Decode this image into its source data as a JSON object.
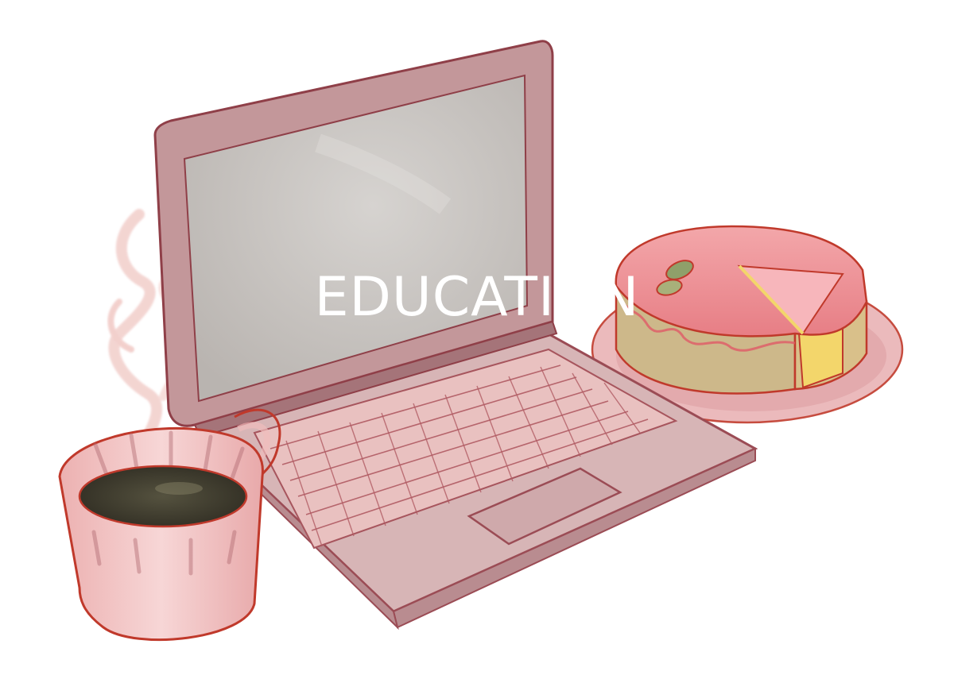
{
  "hero": {
    "title": "EDUCATION"
  },
  "illustration": {
    "style": "watercolor",
    "subjects": [
      "laptop",
      "coffee-mug",
      "cake"
    ],
    "colors": {
      "outline": "#c0392b",
      "laptop_body": "#c9a0a3",
      "screen": "#c9c5c2",
      "keys": "#f2cfcf",
      "mug": "#f4c8c8",
      "coffee": "#3d3a2c",
      "cake_top": "#eb8f93",
      "cake_base": "#cdb88a",
      "plate": "#e7a3a6",
      "title_text": "#ffffff"
    }
  }
}
